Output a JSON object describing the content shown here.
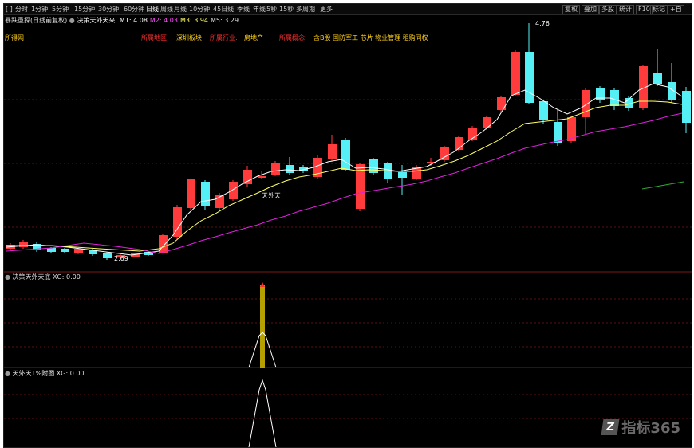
{
  "toolbar": {
    "timeframes": [
      "[ ]",
      "分时",
      "1分钟",
      "5分钟",
      "15分钟",
      "30分钟",
      "60分钟",
      "日线",
      "周线",
      "月线",
      "10分钟",
      "45日线",
      "季线",
      "年线",
      "5秒",
      "15秒",
      "多周期",
      "更多"
    ],
    "active_index": 7,
    "right_buttons": [
      "复权",
      "叠加",
      "多股",
      "统计",
      "F10",
      "标记",
      "+自"
    ]
  },
  "main_panel": {
    "title": "暴跌重探(日线前复权)",
    "indicator_name": "决策天外天来",
    "ma_readout": [
      {
        "label": "M1",
        "value": "4.08",
        "color": "#ffffff"
      },
      {
        "label": "M2",
        "value": "4.03",
        "color": "#ff4dff"
      },
      {
        "label": "M3",
        "value": "3.94",
        "color": "#ffff66"
      },
      {
        "label": "M5",
        "value": "3.29",
        "color": "#dddddd"
      }
    ],
    "stock_tag": "所得网",
    "info_items": [
      {
        "text": "所属地区:",
        "color": "#ff3030"
      },
      {
        "text": "深圳板块",
        "color": "#ffd21a"
      },
      {
        "text": "所属行业:",
        "color": "#ff3030"
      },
      {
        "text": "房地产",
        "color": "#ffd21a"
      },
      {
        "text": "所属概念:",
        "color": "#ff3030"
      },
      {
        "text": "含B股 国防军工 芯片 物业管理 租购同权",
        "color": "#ffd21a"
      }
    ],
    "price_high_label": "4.76",
    "price_low_label": "2.69",
    "signal_label": "天外天",
    "colors": {
      "up": "#ff3b3b",
      "down": "#54f0f5",
      "ma_white": "#ffffff",
      "ma_yellow": "#ffff66",
      "ma_magenta": "#dd22dd",
      "grid": "#5a1010"
    }
  },
  "sub_panel_1": {
    "title": "决策天外天底",
    "readout": "XG: 0.00"
  },
  "sub_panel_2": {
    "title": "天外天1%附图",
    "readout": "XG: 0.00"
  },
  "watermark": {
    "logo_glyph": "Z",
    "text": "指标365"
  }
}
